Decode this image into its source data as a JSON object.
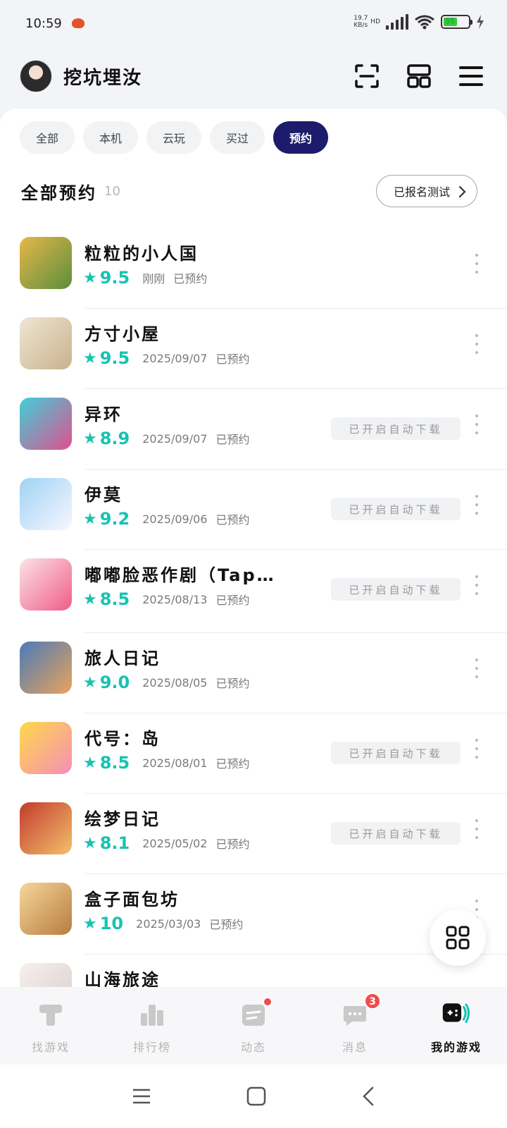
{
  "status_bar": {
    "time": "10:59",
    "net_speed_value": "19.7",
    "net_speed_unit": "KB/s",
    "network_type": "HD",
    "battery_level": "55"
  },
  "header": {
    "user_name": "挖坑埋汝"
  },
  "tabs": [
    {
      "label": "全部",
      "active": false
    },
    {
      "label": "本机",
      "active": false
    },
    {
      "label": "云玩",
      "active": false
    },
    {
      "label": "买过",
      "active": false
    },
    {
      "label": "预约",
      "active": true
    }
  ],
  "section": {
    "title": "全部预约",
    "count": "10",
    "signup_button": "已报名测试"
  },
  "games": [
    {
      "name": "粒粒的小人国",
      "score": "9.5",
      "date": "刚刚",
      "status": "已预约",
      "auto_download": "",
      "colors": [
        "#e7b64a",
        "#5b8f3c"
      ]
    },
    {
      "name": "方寸小屋",
      "score": "9.5",
      "date": "2025/09/07",
      "status": "已预约",
      "auto_download": "",
      "colors": [
        "#efe6d4",
        "#c9b28c"
      ]
    },
    {
      "name": "异环",
      "score": "8.9",
      "date": "2025/09/07",
      "status": "已预约",
      "auto_download": "已开启自动下载",
      "colors": [
        "#3fd0d8",
        "#e04f8f"
      ]
    },
    {
      "name": "伊莫",
      "score": "9.2",
      "date": "2025/09/06",
      "status": "已预约",
      "auto_download": "已开启自动下载",
      "colors": [
        "#9fd3f3",
        "#f7f7ff"
      ]
    },
    {
      "name": "嘟嘟脸恶作剧（Tap…",
      "score": "8.5",
      "date": "2025/08/13",
      "status": "已预约",
      "auto_download": "已开启自动下载",
      "colors": [
        "#fbe3e8",
        "#f05c88"
      ]
    },
    {
      "name": "旅人日记",
      "score": "9.0",
      "date": "2025/08/05",
      "status": "已预约",
      "auto_download": "",
      "colors": [
        "#4a7bb8",
        "#e9a35c"
      ]
    },
    {
      "name": "代号：岛",
      "score": "8.5",
      "date": "2025/08/01",
      "status": "已预约",
      "auto_download": "已开启自动下载",
      "colors": [
        "#ffd84a",
        "#f58fb5"
      ]
    },
    {
      "name": "绘梦日记",
      "score": "8.1",
      "date": "2025/05/02",
      "status": "已预约",
      "auto_download": "已开启自动下载",
      "colors": [
        "#c23b2e",
        "#f4c06b"
      ]
    },
    {
      "name": "盒子面包坊",
      "score": "10",
      "date": "2025/03/03",
      "status": "已预约",
      "auto_download": "",
      "colors": [
        "#f5d79a",
        "#b97c3f"
      ]
    },
    {
      "name": "山海旅途",
      "score": "",
      "date": "",
      "status": "",
      "auto_download": "",
      "colors": [
        "#f6f0ee",
        "#d8cfcc"
      ]
    }
  ],
  "bottom_nav": [
    {
      "label": "找游戏",
      "icon": "find-game-icon",
      "active": false,
      "badge": ""
    },
    {
      "label": "排行榜",
      "icon": "ranking-icon",
      "active": false,
      "badge": ""
    },
    {
      "label": "动态",
      "icon": "feed-icon",
      "active": false,
      "badge": "dot"
    },
    {
      "label": "消息",
      "icon": "message-icon",
      "active": false,
      "badge": "3"
    },
    {
      "label": "我的游戏",
      "icon": "my-games-icon",
      "active": true,
      "badge": ""
    }
  ],
  "colors": {
    "accent_teal": "#17c3b2",
    "active_tab": "#1d1b6b",
    "badge_red": "#f24b4b"
  }
}
